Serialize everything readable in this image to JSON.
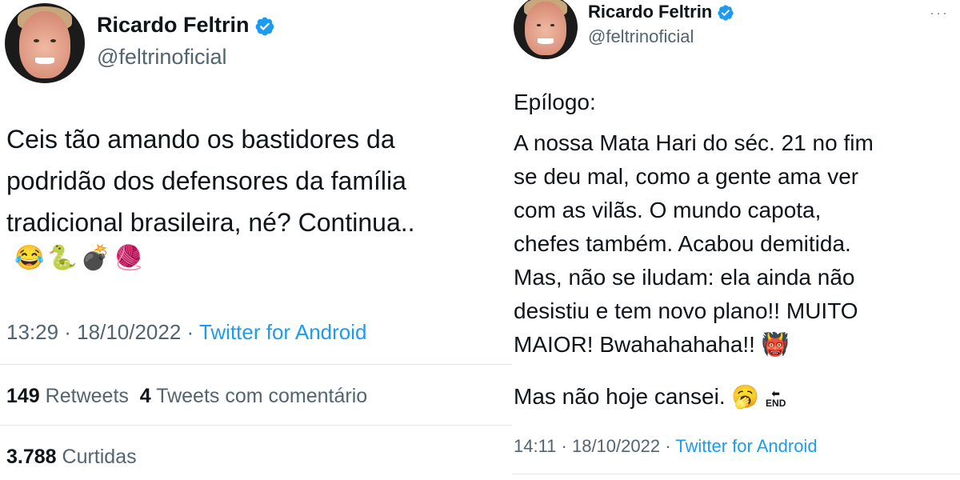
{
  "left_tweet": {
    "author": {
      "name": "Ricardo Feltrin",
      "handle": "@feltrinoficial",
      "verified_color": "#1d9bf0"
    },
    "lines": [
      "Ceis tão amando os bastidores da",
      "podridão dos defensores da família",
      "tradicional brasileira, né? Continua.."
    ],
    "emojis": "😂🐍💣🧶",
    "time": "13:29 · 18/10/2022 ·",
    "source": "Twitter for Android",
    "retweets_count": "149",
    "retweets_label": "Retweets",
    "quotes_count": "4",
    "quotes_label": "Tweets com comentário",
    "likes_count": "3.788",
    "likes_label": "Curtidas"
  },
  "right_tweet": {
    "author": {
      "name": "Ricardo Feltrin",
      "handle": "@feltrinoficial",
      "verified_color": "#1d9bf0"
    },
    "more_label": "···",
    "heading": "Epílogo:",
    "lines": [
      "A nossa Mata Hari do séc. 21 no fim",
      "se deu mal, como a gente ama ver",
      "com as vilãs. O mundo capota,",
      "chefes também. Acabou demitida.",
      "Mas, não se iludam: ela ainda não",
      "desistiu e tem novo plano!! MUITO",
      "MAIOR! Bwahahahaha!! 👹"
    ],
    "closing": "Mas não hoje cansei. 🥱",
    "end_icon_label": "END",
    "time": "14:11 · 18/10/2022 ·",
    "source": "Twitter for Android"
  }
}
